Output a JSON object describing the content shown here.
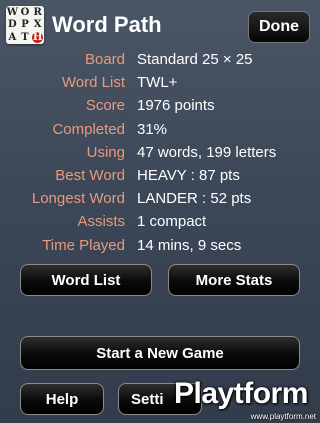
{
  "header": {
    "logo_letters": [
      "W",
      "O",
      "R",
      "D",
      "P",
      "X",
      "A",
      "T",
      "H"
    ],
    "title": "Word Path",
    "done_label": "Done"
  },
  "stats": [
    {
      "label": "Board",
      "value": "Standard 25 × 25"
    },
    {
      "label": "Word List",
      "value": "TWL+"
    },
    {
      "label": "Score",
      "value": "1976 points"
    },
    {
      "label": "Completed",
      "value": "31%"
    },
    {
      "label": "Using",
      "value": "47 words, 199 letters"
    },
    {
      "label": "Best Word",
      "value": "HEAVY : 87 pts"
    },
    {
      "label": "Longest Word",
      "value": "LANDER : 52 pts"
    },
    {
      "label": "Assists",
      "value": "1 compact"
    },
    {
      "label": "Time Played",
      "value": "14 mins, 9 secs"
    }
  ],
  "buttons": {
    "word_list": "Word List",
    "more_stats": "More Stats",
    "new_game": "Start a New Game",
    "help": "Help",
    "settings": "Setti"
  },
  "watermark": {
    "brand": "Playtform",
    "url": "www.playtform.net"
  },
  "colors": {
    "label": "#e89a7e",
    "value": "#ffffff",
    "logo_highlight": "#cc2222"
  }
}
